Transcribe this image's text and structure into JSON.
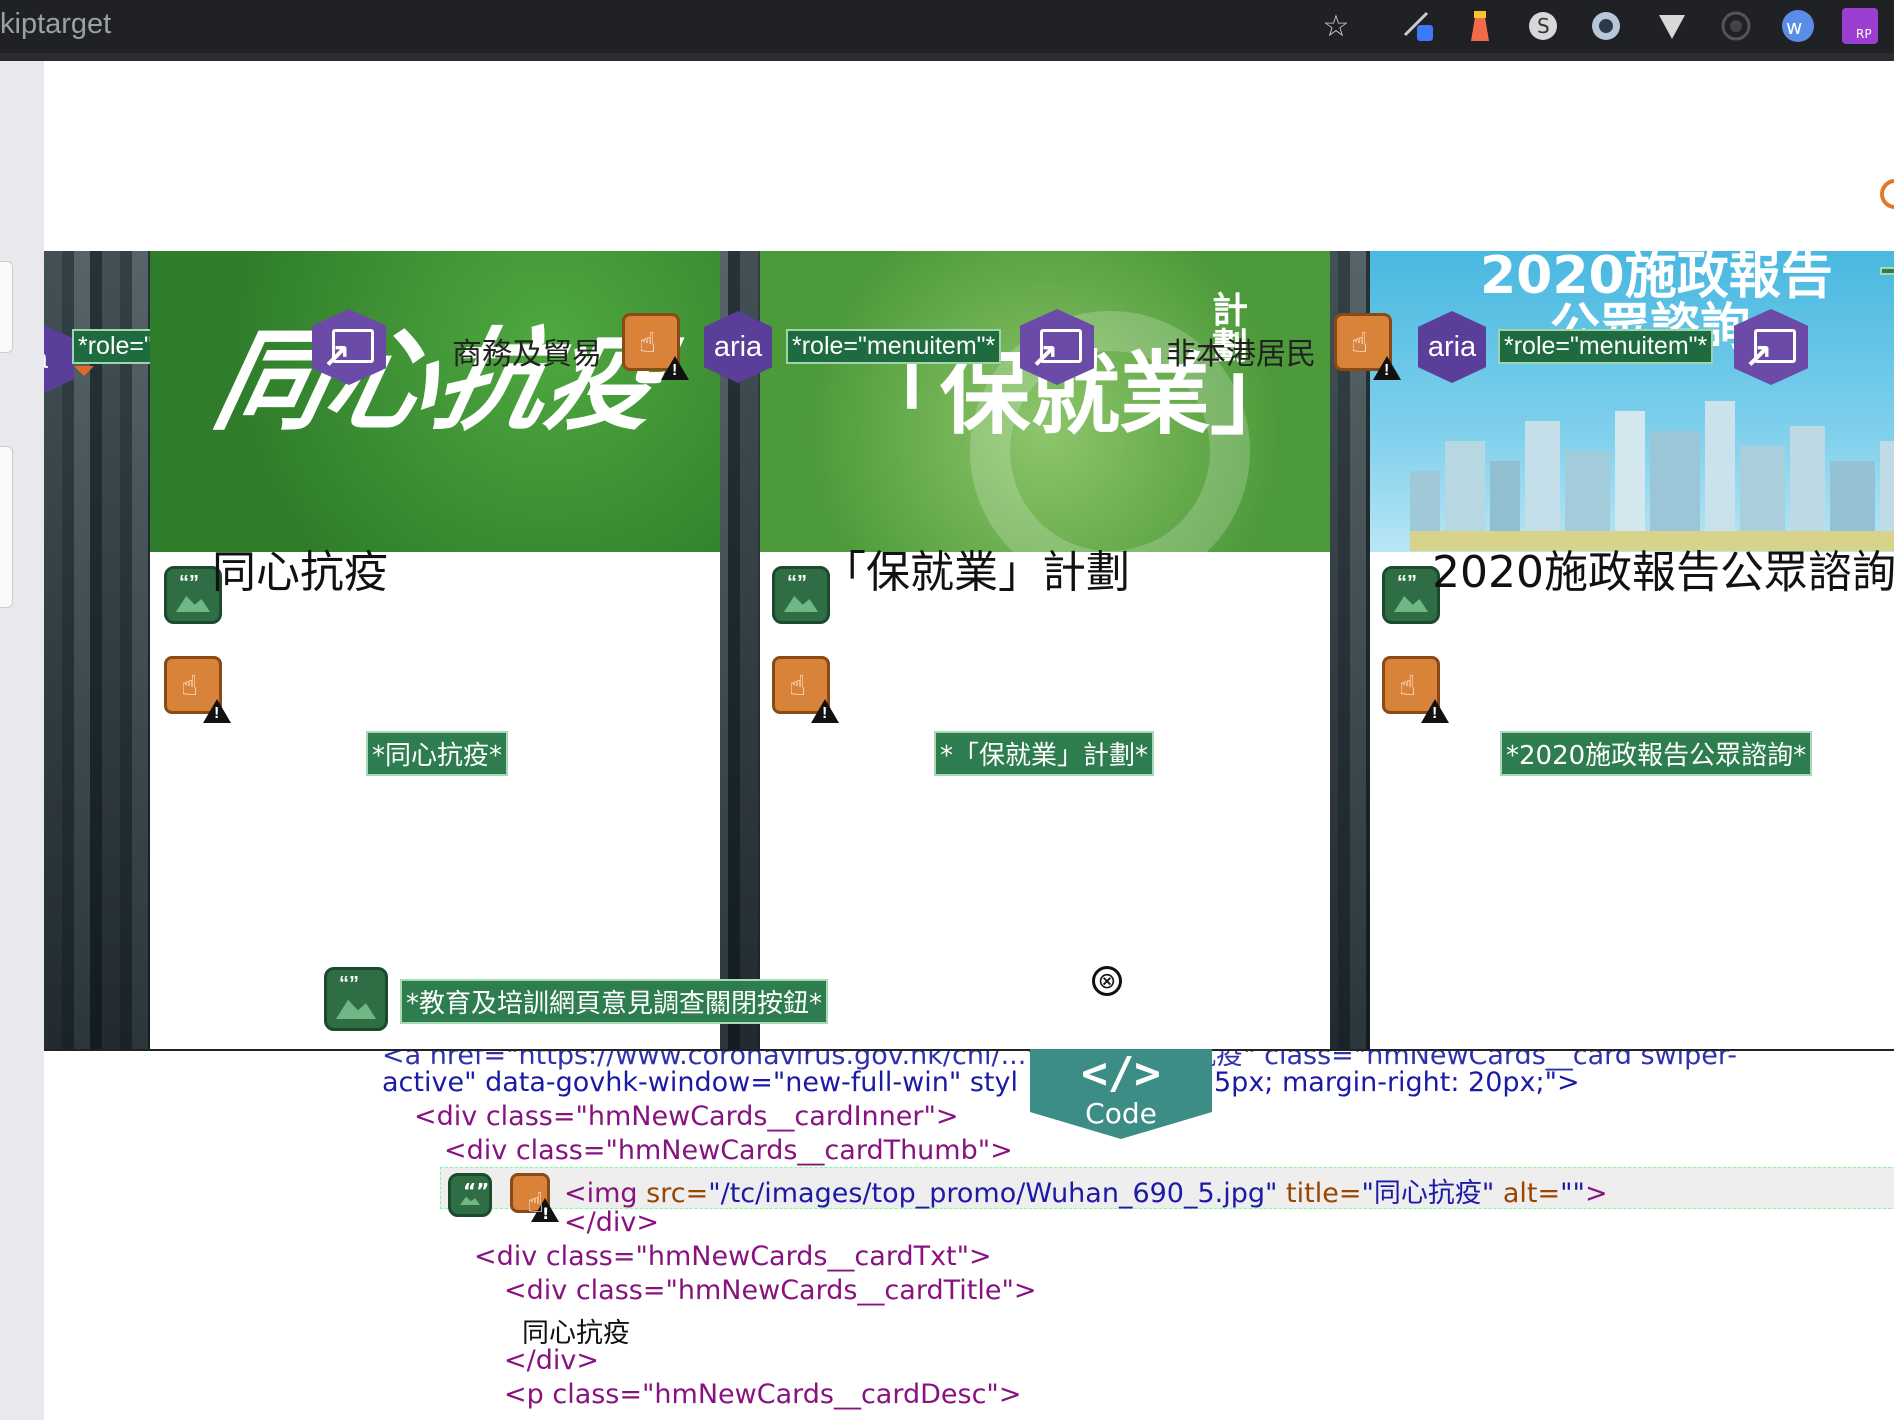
{
  "browser": {
    "url_fragment": "kiptarget",
    "star_glyph": "☆",
    "extensions": [
      "pen-extension-icon",
      "lighthouse-icon",
      "skype-icon",
      "circle-extension-icon",
      "vimium-icon",
      "record-icon",
      "wappalyzer-icon",
      "rp-extension-icon"
    ],
    "rp_label": "RP"
  },
  "cards": [
    {
      "promo_text": "同心抗疫",
      "alt_badge": "*同心抗疫*",
      "title": "同心抗疫",
      "overlay_text": "商務及貿易"
    },
    {
      "promo_text": "「保就業」",
      "promo_small": "計劃",
      "alt_badge": "*「保就業」計劃*",
      "title": "「保就業」計劃",
      "overlay_text": "非本港居民"
    },
    {
      "promo_text": "2020施政報告",
      "promo_sub": "公眾諮詢",
      "alt_badge": "*2020施政報告公眾諮詢*",
      "title": "2020施政報告公眾諮詢",
      "overlay_text": ""
    }
  ],
  "annotations": {
    "role_menuitem": "*role=\"menuitem\"*",
    "aria_label": "aria",
    "aria_partial": "a",
    "close_button_badge": "*教育及培訓網頁意見調查關閉按鈕*",
    "close_glyph": "⊗"
  },
  "code": {
    "badge_symbol": "</>",
    "badge_label": "Code",
    "lines": {
      "l0": "<a href=\"https://www.coronavirus.gov.hk/chi/...\" title=\"同心抗疫\" class=\"hmNewCards__card swiper-",
      "l1a": "active\" data-govhk-window=\"new-full-win\" styl",
      "l1b": "5px; margin-right: 20px;\">",
      "l2": "<div class=\"hmNewCards__cardInner\">",
      "l3": "<div class=\"hmNewCards__cardThumb\">",
      "l4_tag_open": "<img ",
      "l4_src_attr": "src=",
      "l4_src_val": "\"/tc/images/top_promo/Wuhan_690_5.jpg\"",
      "l4_title_attr": " title=",
      "l4_title_val": "\"同心抗疫\"",
      "l4_alt_attr": " alt=",
      "l4_alt_val": "\"\"",
      "l4_close": ">",
      "l5": "</div>",
      "l6": "<div class=\"hmNewCards__cardTxt\">",
      "l7": "<div class=\"hmNewCards__cardTitle\">",
      "l8": "同心抗疫",
      "l9": "</div>",
      "l10": "<p class=\"hmNewCards__cardDesc\">"
    }
  }
}
